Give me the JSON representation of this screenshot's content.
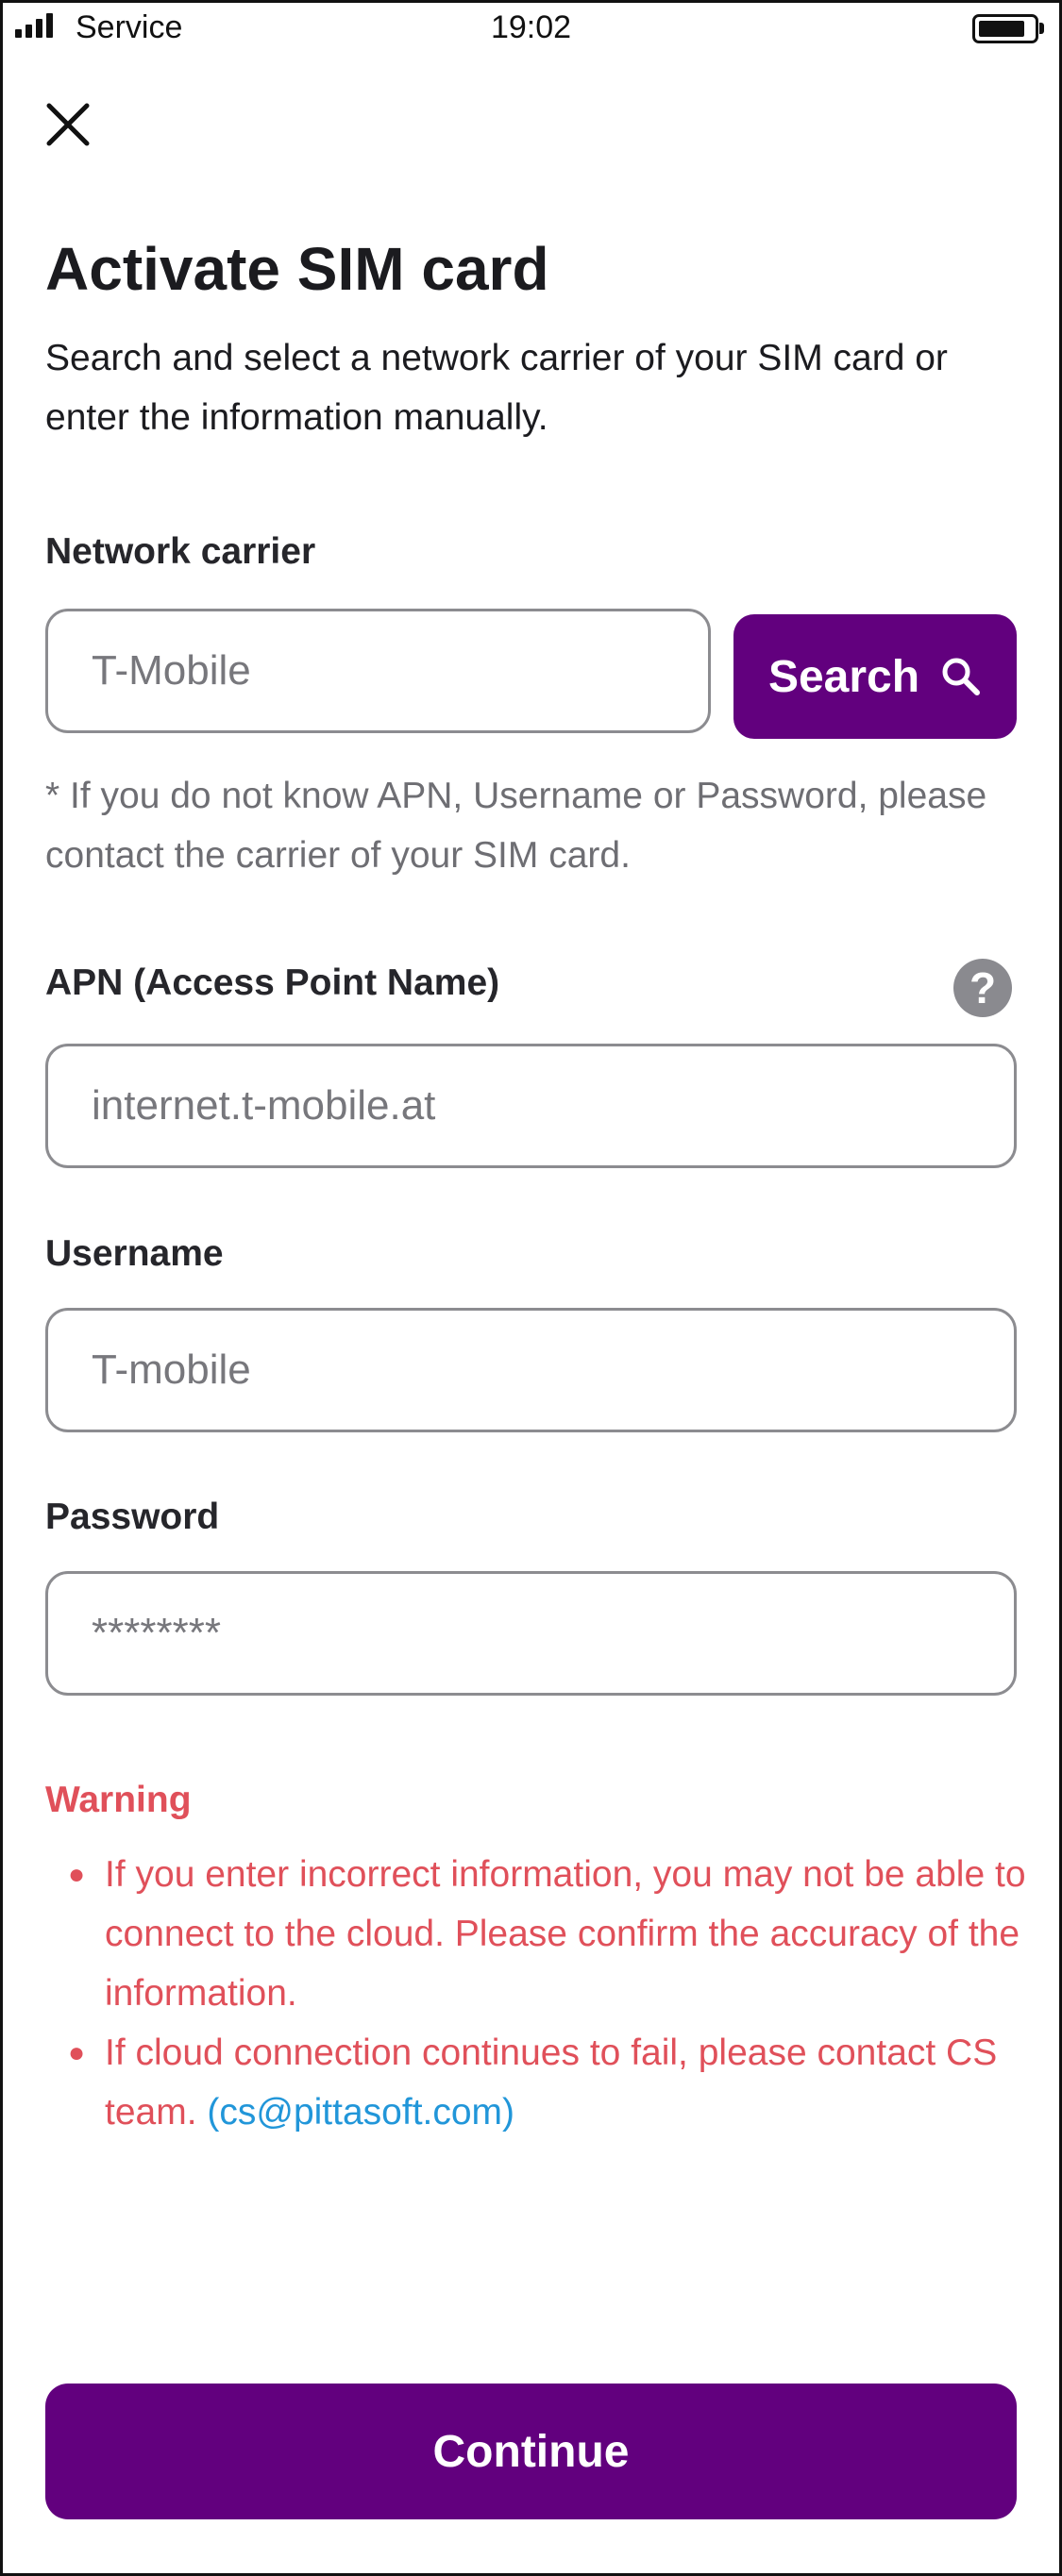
{
  "status_bar": {
    "carrier": "Service",
    "time": "19:02",
    "battery_level": 0.85
  },
  "header": {
    "close_icon": "close-icon"
  },
  "page": {
    "title": "Activate SIM card",
    "subtitle": "Search and select a network carrier of your SIM card or enter the information manually."
  },
  "network_carrier": {
    "label": "Network carrier",
    "placeholder": "T-Mobile",
    "search_label": "Search",
    "search_icon": "search-icon"
  },
  "note": "* If you do not know APN, Username or Password, please contact the carrier of your SIM card.",
  "apn": {
    "label": "APN (Access Point Name)",
    "placeholder": "internet.t-mobile.at",
    "help_icon": "help-icon",
    "help_glyph": "?"
  },
  "username": {
    "label": "Username",
    "placeholder": "T-mobile"
  },
  "password": {
    "label": "Password",
    "placeholder": "********"
  },
  "warning": {
    "title": "Warning",
    "items": [
      "If you enter incorrect information, you may not be able to connect to the cloud. Please confirm the accuracy of the information.",
      "If cloud connection continues to fail, please contact CS team. "
    ],
    "email": "(cs@pittasoft.com)"
  },
  "footer": {
    "continue_label": "Continue"
  },
  "colors": {
    "brand": "#62007e",
    "warning": "#e0505a",
    "link": "#2196d9"
  }
}
